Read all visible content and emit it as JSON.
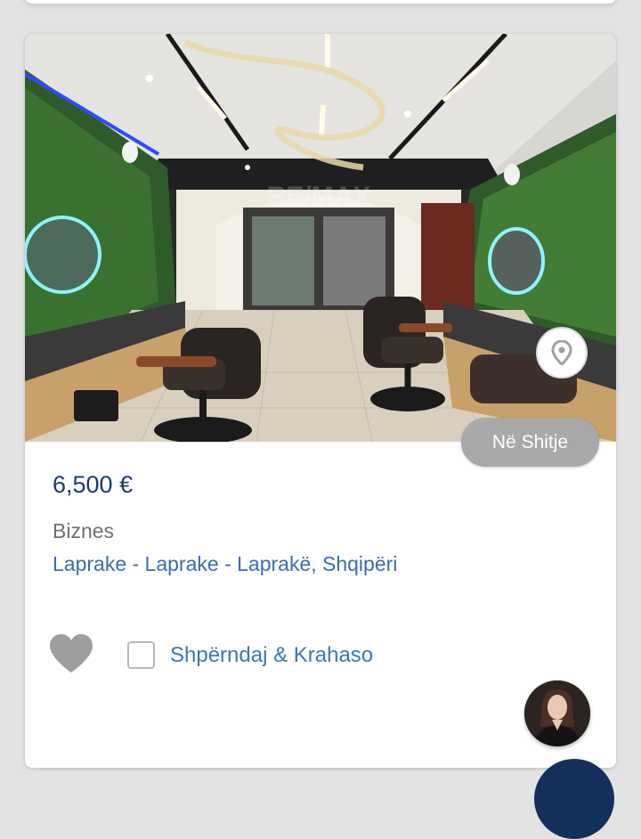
{
  "listing": {
    "price": "6,500 €",
    "type": "Biznes",
    "location": "Laprake - Laprake - Laprakë, Shqipëri",
    "status": "Në Shitje",
    "watermark": "RE/MAX"
  },
  "actions": {
    "share_compare_label": "Shpërndaj & Krahaso"
  },
  "icons": {
    "location": "map-pin-icon",
    "favorite": "heart-icon"
  },
  "colors": {
    "price": "#1d3c66",
    "link": "#3a78b8",
    "badge": "#a9a9a9",
    "heart": "#9e9e9e"
  }
}
